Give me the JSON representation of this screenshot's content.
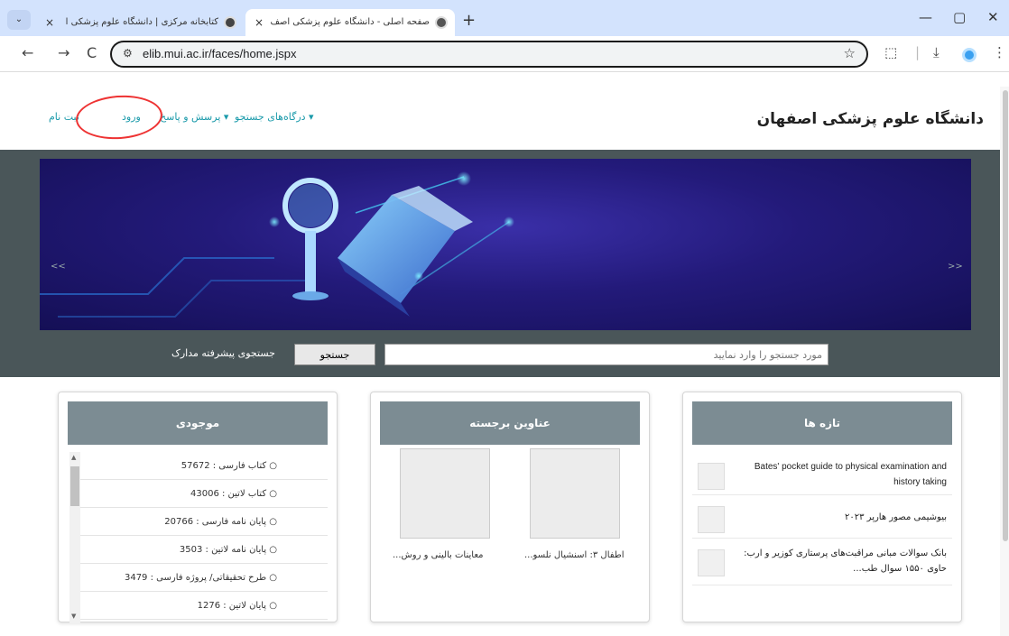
{
  "browser": {
    "tabs": [
      {
        "title": "کتابخانه مرکزی | دانشگاه علوم پزشکی ا",
        "close": "×"
      },
      {
        "title": "صفحه اصلی - دانشگاه علوم پزشکی اصف",
        "close": "×"
      }
    ],
    "tab_menu": "⌄",
    "new_tab": "+",
    "url": "elib.mui.ac.ir/faces/home.jspx",
    "window": {
      "minimize": "—",
      "maximize": "▢",
      "close": "✕"
    }
  },
  "header": {
    "site_title": "دانشگاه علوم پزشکی اصفهان",
    "nav": {
      "register": "ثبت نام",
      "login": "ورود",
      "qa": "پرسش و پاسخ ▾",
      "portals": "درگاه‌های جستجو ▾"
    }
  },
  "hero": {
    "prev": "<<",
    "next": ">>"
  },
  "search": {
    "placeholder": "مورد جستجو را وارد نمایید",
    "button": "جستجو",
    "advanced": "جستجوی پیشرفته مدارک"
  },
  "stock": {
    "title": "موجودی",
    "items": [
      "○ کتاب فارسی : 57672",
      "○ کتاب لاتین : 43006",
      "○ پایان نامه فارسی : 20766",
      "○ پایان نامه لاتین : 3503",
      "○ طرح تحقیقاتی/ پروژه فارسی : 3479",
      "○ پایان لاتین : 1276"
    ]
  },
  "featured": {
    "title": "عناوین برجسته",
    "items": [
      {
        "caption": "اطفال ۳: اسنشیال نلسو..."
      },
      {
        "caption": "معاینات بالینی و روش..."
      }
    ]
  },
  "latest": {
    "title": "تازه ها",
    "items": [
      "Bates' pocket guide to physical examination and history taking",
      "بیوشیمی مصور هارپر ۲۰۲۳",
      "بانک سوالات مبانی مراقبت‌های پرستاری کوزیر و ارب: حاوی ۱۵۵۰ سوال طب..."
    ]
  }
}
